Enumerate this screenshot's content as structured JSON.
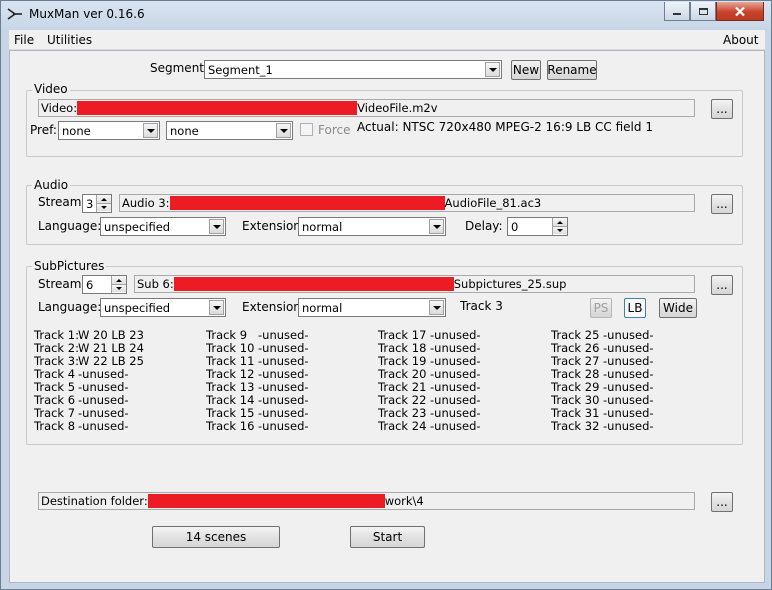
{
  "window": {
    "title": "MuxMan ver 0.16.6"
  },
  "menu": {
    "file": "File",
    "utilities": "Utilities",
    "about": "About"
  },
  "segment": {
    "label": "Segment:",
    "value": "Segment_1",
    "new_label": "New",
    "rename_label": "Rename"
  },
  "video": {
    "group_label": "Video",
    "file_prefix": "Video:",
    "file_suffix": "VideoFile.m2v",
    "browse": "...",
    "pref_label": "Pref:",
    "pref1": "none",
    "pref2": "none",
    "force_label": "Force",
    "actual": "Actual:  NTSC 720x480  MPEG-2  16:9 LB  CC field 1"
  },
  "audio": {
    "group_label": "Audio",
    "stream_label": "Stream:",
    "stream_value": "3",
    "file_prefix": "Audio 3:",
    "file_suffix": "AudioFile_81.ac3",
    "browse": "...",
    "language_label": "Language:",
    "language_value": "unspecified",
    "extension_label": "Extension:",
    "extension_value": "normal",
    "delay_label": "Delay:",
    "delay_value": "0"
  },
  "subpictures": {
    "group_label": "SubPictures",
    "stream_label": "Stream:",
    "stream_value": "6",
    "file_prefix": "Sub 6:",
    "file_suffix": "Subpictures_25.sup",
    "browse": "...",
    "language_label": "Language:",
    "language_value": "unspecified",
    "extension_label": "Extension:",
    "extension_value": "normal",
    "track_label": "Track 3",
    "ps_label": "PS",
    "lb_label": "LB",
    "wide_label": "Wide",
    "tracks": [
      [
        "Track 1:",
        "W 20  LB 23"
      ],
      [
        "Track 2:",
        "W 21  LB 24"
      ],
      [
        "Track 3:",
        "W 22  LB 25"
      ],
      [
        "Track 4",
        "-unused-"
      ],
      [
        "Track 5",
        "-unused-"
      ],
      [
        "Track 6",
        "-unused-"
      ],
      [
        "Track 7",
        "-unused-"
      ],
      [
        "Track 8",
        "-unused-"
      ],
      [
        "Track 9",
        "-unused-"
      ],
      [
        "Track 10",
        "-unused-"
      ],
      [
        "Track 11",
        "-unused-"
      ],
      [
        "Track 12",
        "-unused-"
      ],
      [
        "Track 13",
        "-unused-"
      ],
      [
        "Track 14",
        "-unused-"
      ],
      [
        "Track 15",
        "-unused-"
      ],
      [
        "Track 16",
        "-unused-"
      ],
      [
        "Track 17",
        "-unused-"
      ],
      [
        "Track 18",
        "-unused-"
      ],
      [
        "Track 19",
        "-unused-"
      ],
      [
        "Track 20",
        "-unused-"
      ],
      [
        "Track 21",
        "-unused-"
      ],
      [
        "Track 22",
        "-unused-"
      ],
      [
        "Track 23",
        "-unused-"
      ],
      [
        "Track 24",
        "-unused-"
      ],
      [
        "Track 25",
        "-unused-"
      ],
      [
        "Track 26",
        "-unused-"
      ],
      [
        "Track 27",
        "-unused-"
      ],
      [
        "Track 28",
        "-unused-"
      ],
      [
        "Track 29",
        "-unused-"
      ],
      [
        "Track 30",
        "-unused-"
      ],
      [
        "Track 31",
        "-unused-"
      ],
      [
        "Track 32",
        "-unused-"
      ]
    ]
  },
  "destination": {
    "label": "Destination folder:",
    "suffix": "work\\4",
    "browse": "..."
  },
  "actions": {
    "scenes_label": "14 scenes",
    "start_label": "Start"
  },
  "colors": {
    "redaction": "#ed1c24",
    "window_frame": "#c7d5e6",
    "close_button": "#c8442d"
  },
  "icons": [
    "app-icon",
    "minimize-icon",
    "maximize-icon",
    "close-icon",
    "chevron-down-icon",
    "spin-up-icon",
    "spin-down-icon"
  ]
}
